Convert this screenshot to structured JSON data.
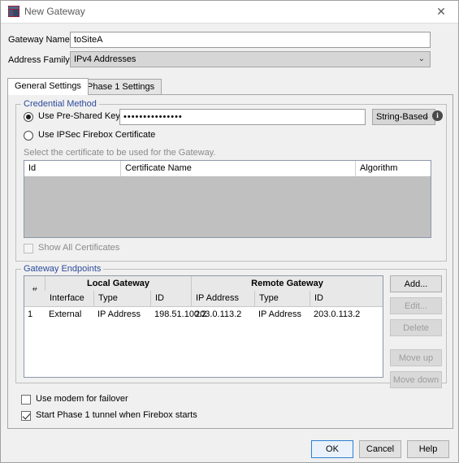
{
  "window": {
    "title": "New Gateway",
    "icon": "app-window-icon",
    "close_label": "✕"
  },
  "form": {
    "gateway_name_label": "Gateway Name:",
    "gateway_name_value": "toSiteA",
    "address_family_label": "Address Family:",
    "address_family_value": "IPv4 Addresses",
    "caret": "⌄"
  },
  "tabs": [
    {
      "label": "General Settings",
      "active": true
    },
    {
      "label": "Phase 1 Settings",
      "active": false
    }
  ],
  "credential_method": {
    "title": "Credential Method",
    "psk_label": "Use Pre-Shared Key",
    "psk_selected": true,
    "psk_value": "•••••••••••••••",
    "psk_format_value": "String-Based",
    "psk_format_caret": "⌄",
    "info_icon": "i",
    "cert_label": "Use IPSec Firebox Certificate",
    "cert_selected": false,
    "hint": "Select the certificate to be used for the Gateway.",
    "cert_table": {
      "columns": [
        "Id",
        "Certificate Name",
        "Algorithm"
      ],
      "rows": []
    },
    "show_all_label": "Show All Certificates",
    "show_all_checked": false
  },
  "gateway_endpoints": {
    "title": "Gateway Endpoints",
    "group_headers": [
      "#",
      "Local Gateway",
      "Remote Gateway"
    ],
    "columns": [
      "#",
      "Interface",
      "Type",
      "ID",
      "IP Address",
      "Type",
      "ID"
    ],
    "rows": [
      {
        "num": "1",
        "interface": "External",
        "local_type": "IP Address",
        "local_id": "198.51.100.2",
        "remote_ip": "203.0.113.2",
        "remote_type": "IP Address",
        "remote_id": "203.0.113.2"
      }
    ],
    "buttons": [
      {
        "label": "Add...",
        "enabled": true
      },
      {
        "label": "Edit...",
        "enabled": false
      },
      {
        "label": "Delete",
        "enabled": false
      },
      {
        "label": "Move up",
        "enabled": false
      },
      {
        "label": "Move down",
        "enabled": false
      }
    ]
  },
  "options": {
    "modem_label": "Use modem for failover",
    "modem_checked": false,
    "start_phase1_label": "Start Phase 1 tunnel when Firebox starts",
    "start_phase1_checked": true
  },
  "dialog_buttons": {
    "ok": "OK",
    "cancel": "Cancel",
    "help": "Help"
  },
  "colors": {
    "group_title": "#2b4a9b",
    "default_button_border": "#2f7fd1"
  }
}
